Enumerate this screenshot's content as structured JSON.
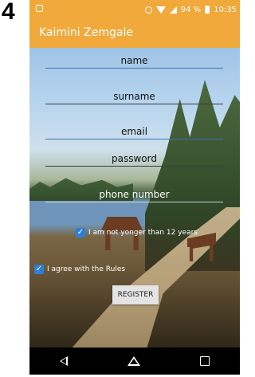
{
  "step_number": "4",
  "status_bar": {
    "battery": "94 %",
    "time": "10:35"
  },
  "app_bar": {
    "title": "Kaimini Zemgale"
  },
  "form": {
    "fields": [
      {
        "label": "name"
      },
      {
        "label": "surname"
      },
      {
        "label": "email"
      },
      {
        "label": "password"
      },
      {
        "label": "phone number"
      }
    ],
    "checkboxes": [
      {
        "label": "I am not yonger than 12 years",
        "checked": true
      },
      {
        "label": "I agree with the Rules",
        "checked": true
      }
    ],
    "register_label": "REGISTER"
  },
  "colors": {
    "accent": "#f0a93a",
    "checkbox": "#2f7fd6",
    "field_underline": "#3f6fb5"
  },
  "icons": [
    "notification-icon",
    "alarm-icon",
    "wifi-icon",
    "signal-icon",
    "battery-icon",
    "back-icon",
    "home-icon",
    "recent-apps-icon"
  ]
}
